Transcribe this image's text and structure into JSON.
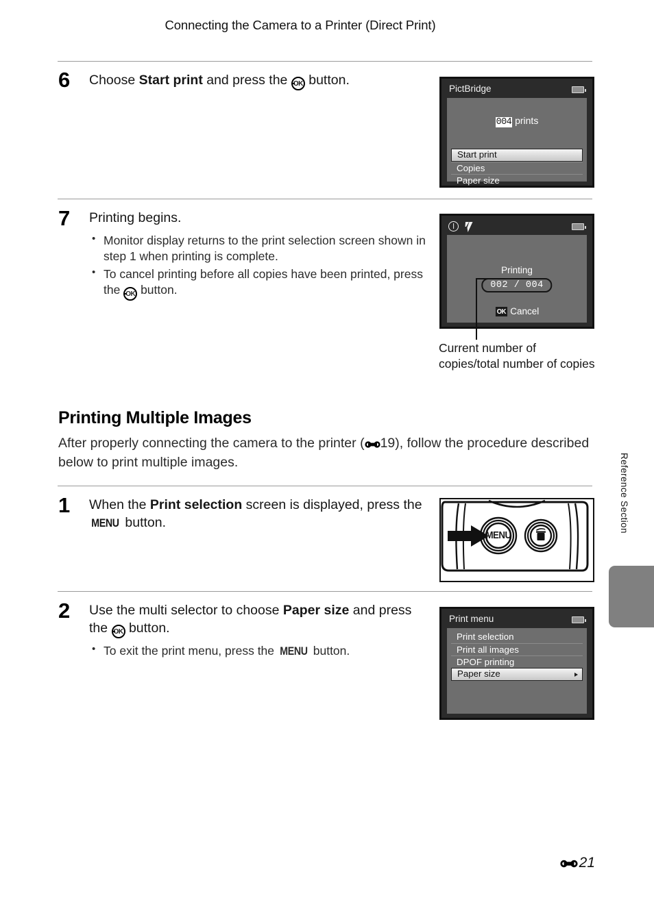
{
  "running_header": "Connecting the Camera to a Printer (Direct Print)",
  "steps": [
    {
      "number": "6",
      "text_parts": {
        "a": "Choose ",
        "b": "Start print",
        "c": " and press the ",
        "d": " button."
      }
    },
    {
      "number": "7",
      "heading": "Printing begins.",
      "bullets": [
        {
          "a": "Monitor display returns to the print selection screen shown in step 1 when printing is complete."
        },
        {
          "a": "To cancel printing before all copies have been printed, press the ",
          "b": " button."
        }
      ]
    },
    {
      "number": "1",
      "text_parts": {
        "a": "When the ",
        "b": "Print selection",
        "c": " screen is displayed, press the ",
        "d": " button."
      }
    },
    {
      "number": "2",
      "text_parts": {
        "a": "Use the multi selector to choose ",
        "b": "Paper size",
        "c": " and press the ",
        "d": " button."
      },
      "bullets": [
        {
          "a": "To exit the print menu, press the ",
          "b": " button."
        }
      ]
    }
  ],
  "section": {
    "heading": "Printing Multiple Images",
    "paragraph_a": "After properly connecting the camera to the printer (",
    "paragraph_ref": "19",
    "paragraph_b": "), follow the procedure described below to print multiple images."
  },
  "pictbridge_screen": {
    "title": "PictBridge",
    "prints_count": "004",
    "prints_label": "prints",
    "menu_items": [
      {
        "label": "Start print",
        "selected": true
      },
      {
        "label": "Copies",
        "selected": false
      },
      {
        "label": "Paper size",
        "selected": false
      }
    ],
    "battery_icon": "battery-icon"
  },
  "printing_screen": {
    "power_icon": "power-indicator-icon",
    "flash_icon": "flash-icon",
    "battery_icon": "battery-icon",
    "status_label": "Printing",
    "counter": "002 / 004",
    "cancel_badge": "OK",
    "cancel_label": "Cancel"
  },
  "callout_caption": "Current number of copies/total number of copies",
  "camera_illustration": {
    "menu_button_label": "MENU",
    "delete_button_icon": "trash-icon",
    "arrow_icon": "right-arrow-icon"
  },
  "print_menu_screen": {
    "title": "Print menu",
    "battery_icon": "battery-icon",
    "menu_items": [
      {
        "label": "Print selection",
        "selected": false,
        "arrow": false
      },
      {
        "label": "Print all images",
        "selected": false,
        "arrow": false
      },
      {
        "label": "DPOF printing",
        "selected": false,
        "arrow": false
      },
      {
        "label": "Paper size",
        "selected": true,
        "arrow": true
      }
    ]
  },
  "side_tab_label": "Reference Section",
  "folio": "21",
  "colors": {
    "lcd_header": "#2b2b2b",
    "lcd_body": "#6e6e6e",
    "selected_row": "#dcdcdc",
    "side_tab": "#808080",
    "rule": "#9a9a9a"
  }
}
